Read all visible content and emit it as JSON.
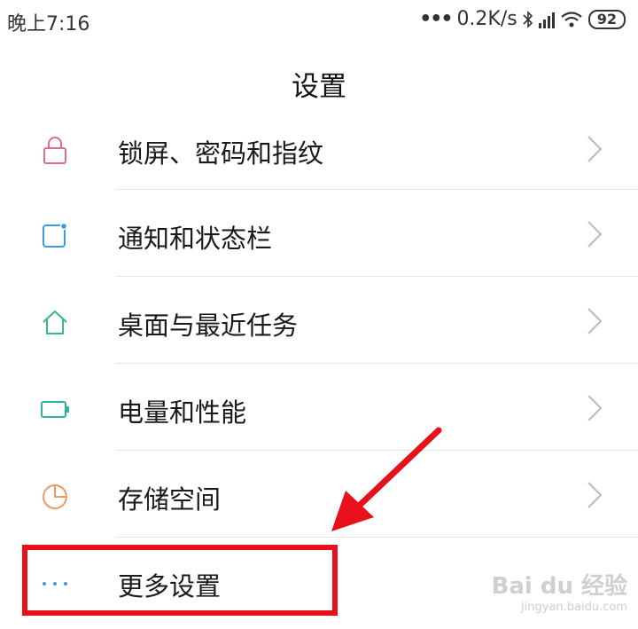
{
  "status_bar": {
    "time": "晚上7:16",
    "network_speed": "0.2K/s",
    "battery": "92",
    "icons": [
      "more-dots-icon",
      "bluetooth-icon",
      "hd-signal-icon",
      "wifi-icon",
      "battery-icon"
    ]
  },
  "header": {
    "title": "设置"
  },
  "settings_items": [
    {
      "label": "锁屏、密码和指纹",
      "icon": "lock-icon",
      "icon_color": "#e06c86"
    },
    {
      "label": "通知和状态栏",
      "icon": "notification-icon",
      "icon_color": "#3a9bd9"
    },
    {
      "label": "桌面与最近任务",
      "icon": "home-icon",
      "icon_color": "#3cb58f"
    },
    {
      "label": "电量和性能",
      "icon": "battery-icon",
      "icon_color": "#2bb3a8"
    },
    {
      "label": "存储空间",
      "icon": "pie-chart-icon",
      "icon_color": "#ec9a64"
    },
    {
      "label": "更多设置",
      "icon": "more-dots-icon",
      "icon_color": "#3a9bd9"
    }
  ],
  "annotation": {
    "highlight_color": "#e8101a"
  },
  "watermark": {
    "text": "Bai du 经验",
    "url_text": "jingyan.baidu.com"
  }
}
